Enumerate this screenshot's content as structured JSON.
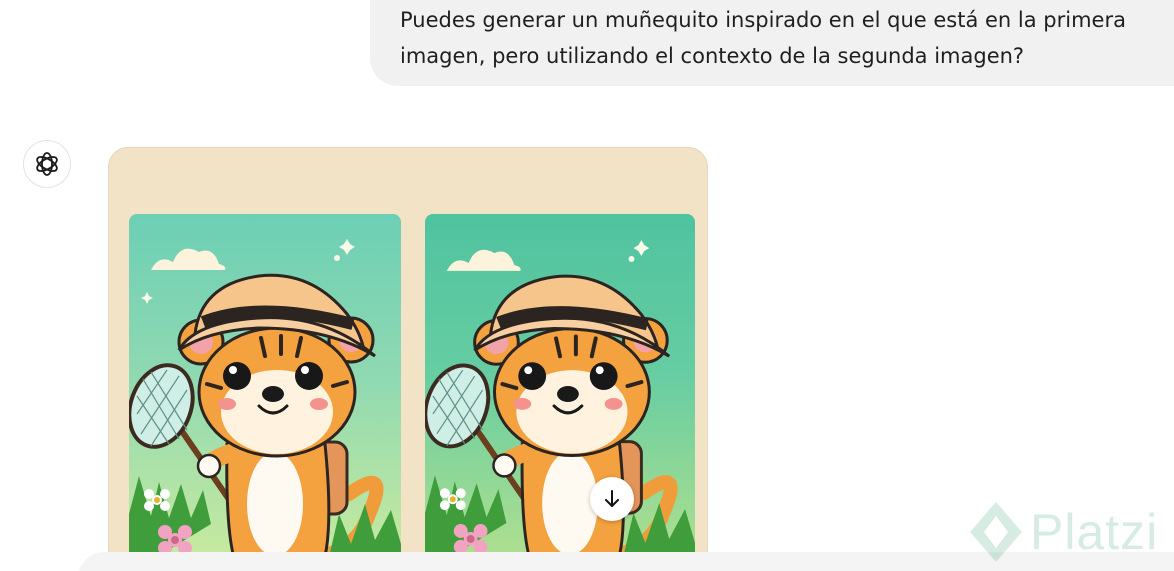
{
  "user_message": {
    "line1": "Puedes generar un muñequito inspirado en el que está en la primera",
    "line2": "imagen, pero utilizando el contexto de la segunda imagen?"
  },
  "assistant": {
    "avatar_icon": "openai-logo-icon"
  },
  "generated_image": {
    "alt": "",
    "download_icon": "arrow-down-icon"
  },
  "watermark": {
    "text": "Platzi",
    "color": "#0b8e57"
  }
}
